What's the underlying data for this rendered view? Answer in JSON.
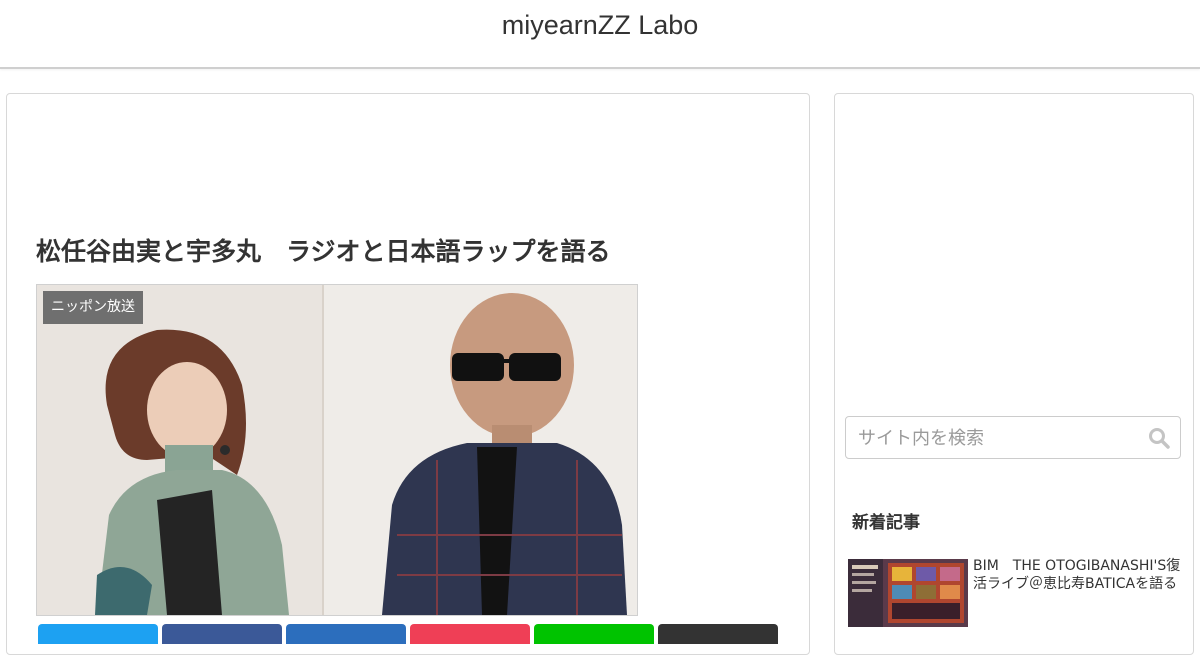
{
  "site": {
    "title": "miyearnZZ Labo"
  },
  "article": {
    "title": "松任谷由実と宇多丸　ラジオと日本語ラップを語る",
    "category_label": "ニッポン放送"
  },
  "share_buttons": [
    {
      "name": "twitter",
      "color": "#1da1f2"
    },
    {
      "name": "facebook",
      "color": "#3b5998"
    },
    {
      "name": "hatena",
      "color": "#2c6ebd"
    },
    {
      "name": "pocket",
      "color": "#ef3f56"
    },
    {
      "name": "line",
      "color": "#00c300"
    },
    {
      "name": "copy",
      "color": "#333333"
    }
  ],
  "sidebar": {
    "search": {
      "placeholder": "サイト内を検索",
      "icon": "search-icon"
    },
    "new_posts": {
      "heading": "新着記事",
      "items": [
        {
          "title": "BIM　THE OTOGIBANASHI'S復活ライブ＠恵比寿BATICAを語る"
        }
      ]
    }
  },
  "colors": {
    "header_border": "#cfcfcf",
    "category_bg": "#6f6f6f",
    "text": "#333333"
  }
}
